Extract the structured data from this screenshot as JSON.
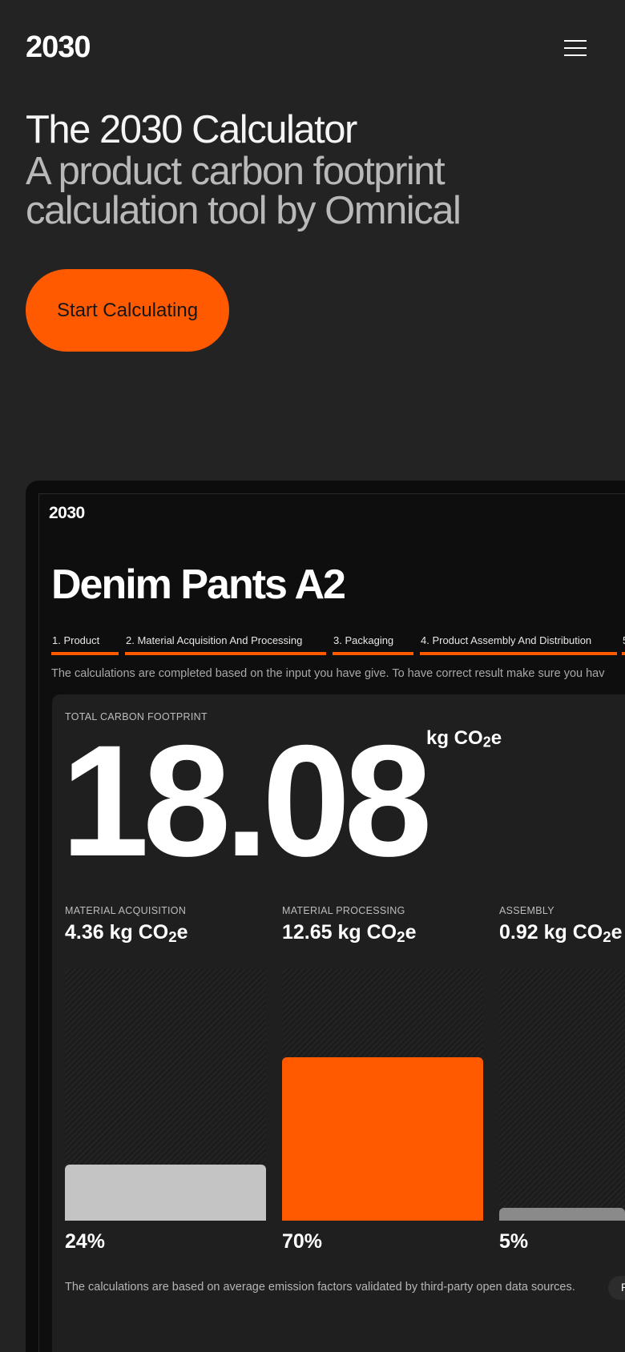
{
  "header": {
    "logo": "2030",
    "menu_icon": "hamburger-menu-icon"
  },
  "hero": {
    "title": "The 2030 Calculator",
    "subtitle": "A product carbon footprint calculation tool by Omnical",
    "cta_label": "Start Calculating"
  },
  "colors": {
    "accent": "#ff5a00",
    "background": "#232323",
    "panel": "#1f1f1f",
    "bar_neutral": "#c4c4c4",
    "bar_dim": "#8a8a8a"
  },
  "app": {
    "logo": "2030",
    "product_title": "Denim Pants A2",
    "steps": [
      {
        "label": "1. Product"
      },
      {
        "label": "2. Material Acquisition And Processing"
      },
      {
        "label": "3. Packaging"
      },
      {
        "label": "4. Product Assembly And Distribution"
      },
      {
        "label": "5"
      }
    ],
    "note": "The calculations are completed based on the input you have give. To have correct result make sure you hav",
    "total": {
      "label": "TOTAL CARBON FOOTPRINT",
      "value": "18.08",
      "unit_prefix": "kg CO",
      "unit_sub": "2",
      "unit_suffix": "e"
    },
    "metrics": [
      {
        "label": "MATERIAL ACQUISITION",
        "value": "4.36 kg CO",
        "sub": "2",
        "suffix": "e",
        "percent_label": "24%",
        "percent": 24,
        "color": "#c4c4c4"
      },
      {
        "label": "MATERIAL PROCESSING",
        "value": "12.65 kg CO",
        "sub": "2",
        "suffix": "e",
        "percent_label": "70%",
        "percent": 70,
        "color": "#ff5a00"
      },
      {
        "label": "ASSEMBLY",
        "value": "0.92 kg CO",
        "sub": "2",
        "suffix": "e",
        "percent_label": "5%",
        "percent": 5,
        "color": "#8a8a8a"
      }
    ],
    "footer_note": "The calculations are based on average emission factors validated by third-party open data sources.",
    "footer_pill": "R"
  }
}
